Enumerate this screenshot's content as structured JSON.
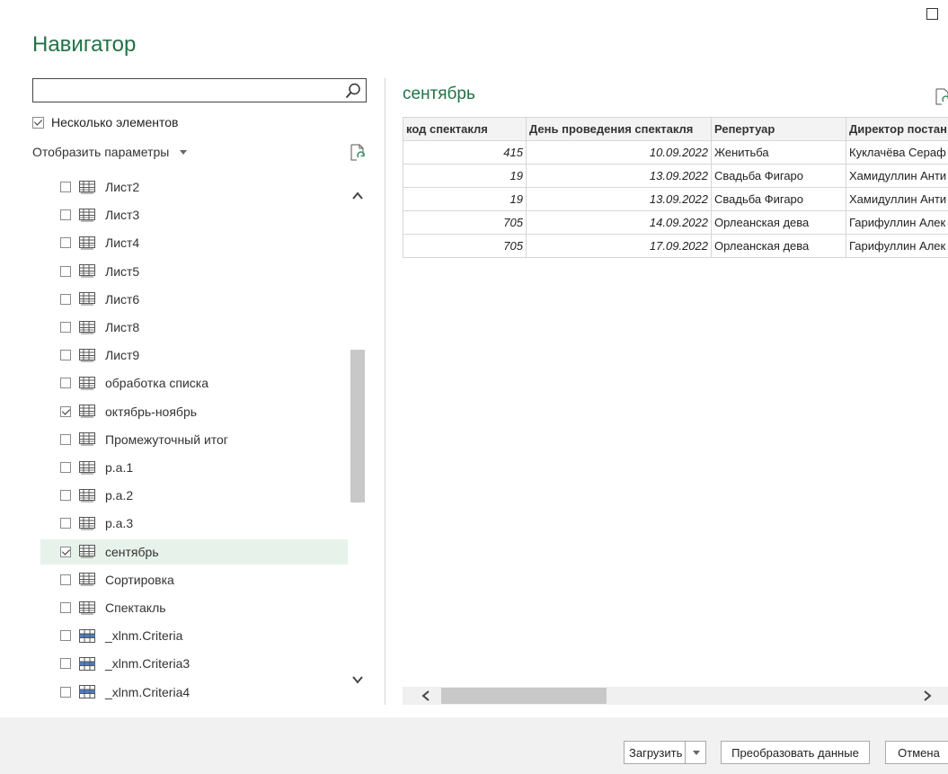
{
  "window": {
    "title": "Навигатор"
  },
  "search": {
    "value": "",
    "placeholder": ""
  },
  "multi_select": {
    "label": "Несколько элементов",
    "checked": true
  },
  "display_options": {
    "label": "Отобразить параметры"
  },
  "items": [
    {
      "label": "Лист2",
      "checked": false,
      "icon": "sheet-icon"
    },
    {
      "label": "Лист3",
      "checked": false,
      "icon": "sheet-icon"
    },
    {
      "label": "Лист4",
      "checked": false,
      "icon": "sheet-icon"
    },
    {
      "label": "Лист5",
      "checked": false,
      "icon": "sheet-icon"
    },
    {
      "label": "Лист6",
      "checked": false,
      "icon": "sheet-icon"
    },
    {
      "label": "Лист8",
      "checked": false,
      "icon": "sheet-icon"
    },
    {
      "label": "Лист9",
      "checked": false,
      "icon": "sheet-icon"
    },
    {
      "label": "обработка списка",
      "checked": false,
      "icon": "sheet-icon"
    },
    {
      "label": "октябрь-ноябрь",
      "checked": true,
      "icon": "sheet-icon"
    },
    {
      "label": "Промежуточный итог",
      "checked": false,
      "icon": "sheet-icon"
    },
    {
      "label": "р.а.1",
      "checked": false,
      "icon": "sheet-icon"
    },
    {
      "label": "р.а.2",
      "checked": false,
      "icon": "sheet-icon"
    },
    {
      "label": "р.а.3",
      "checked": false,
      "icon": "sheet-icon"
    },
    {
      "label": "сентябрь",
      "checked": true,
      "selected": true,
      "icon": "sheet-icon"
    },
    {
      "label": "Сортировка",
      "checked": false,
      "icon": "sheet-icon"
    },
    {
      "label": "Спектакль",
      "checked": false,
      "icon": "sheet-icon"
    },
    {
      "label": "_xlnm.Criteria",
      "checked": false,
      "icon": "named-range-icon"
    },
    {
      "label": "_xlnm.Criteria3",
      "checked": false,
      "icon": "named-range-icon"
    },
    {
      "label": "_xlnm.Criteria4",
      "checked": false,
      "icon": "named-range-icon"
    }
  ],
  "preview": {
    "title": "сентябрь",
    "columns": [
      "код спектакля",
      "День проведения спектакля",
      "Репертуар",
      "Директор постан"
    ],
    "rows": [
      [
        "415",
        "10.09.2022",
        "Женитьба",
        "Куклачёва Сераф"
      ],
      [
        "19",
        "13.09.2022",
        "Свадьба Фигаро",
        "Хамидуллин Анти"
      ],
      [
        "19",
        "13.09.2022",
        "Свадьба Фигаро",
        "Хамидуллин Анти"
      ],
      [
        "705",
        "14.09.2022",
        "Орлеанская дева",
        "Гарифуллин Алек"
      ],
      [
        "705",
        "17.09.2022",
        "Орлеанская дева",
        "Гарифуллин Алек"
      ]
    ]
  },
  "buttons": {
    "load": "Загрузить",
    "transform": "Преобразовать данные",
    "cancel": "Отмена"
  },
  "colors": {
    "accent": "#217346",
    "selected_row": "#e6f2ea",
    "footer": "#f1f1f1"
  }
}
